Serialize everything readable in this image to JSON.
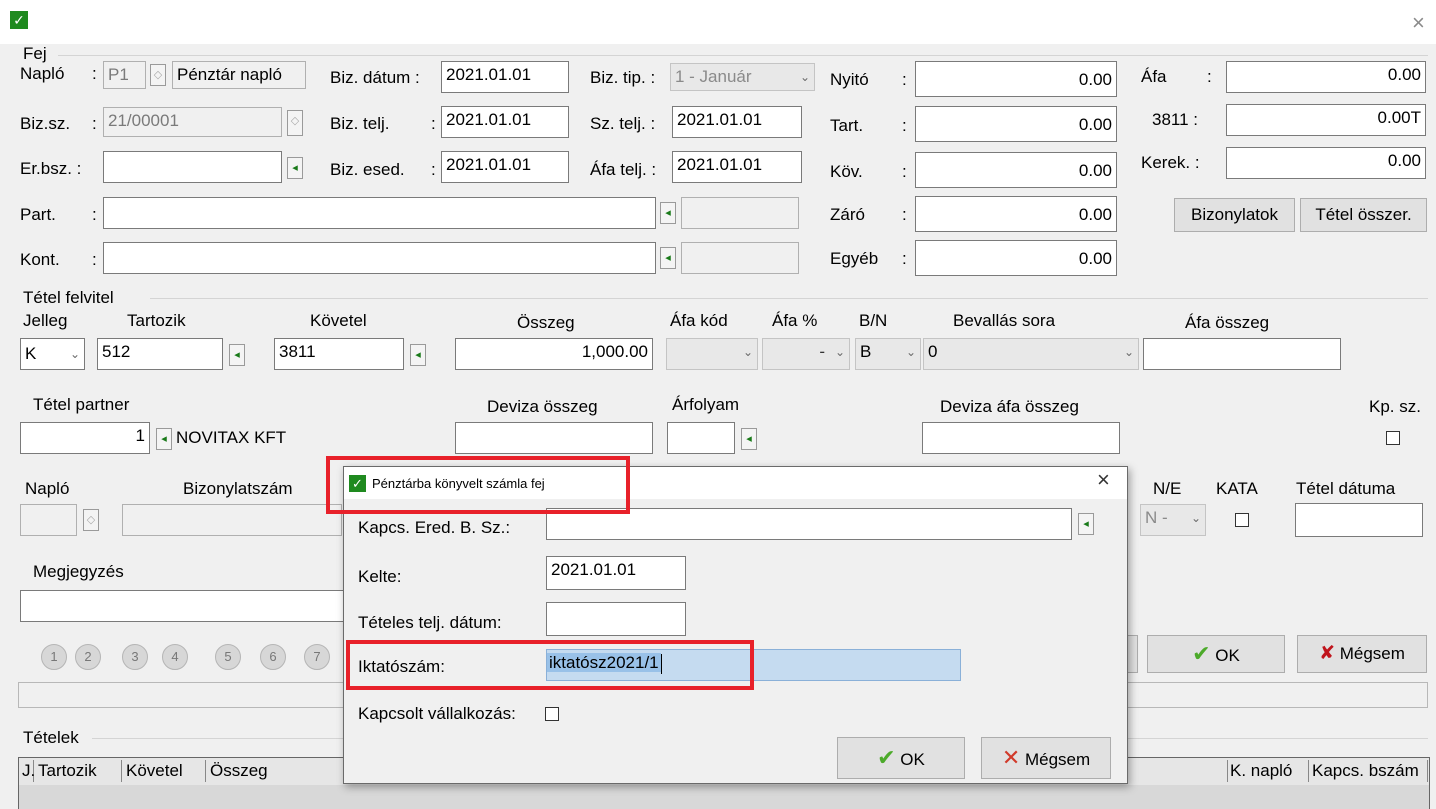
{
  "window": {
    "close_glyph": "×"
  },
  "fej": {
    "group": "Fej",
    "naplo_label": "Napló",
    "naplo_code": "P1",
    "naplo_name": "Pénztár napló",
    "bizsz_label": "Biz.sz.",
    "bizsz_value": "21/00001",
    "erbsz_label": "Er.bsz. :",
    "part_label": "Part.",
    "kont_label": "Kont.",
    "biz_datum_label": "Biz. dátum :",
    "biz_datum_value": "2021.01.01",
    "biz_telj_label": "Biz. telj.",
    "biz_telj_value": "2021.01.01",
    "biz_esed_label": "Biz. esed.",
    "biz_esed_value": "2021.01.01",
    "biz_tip_label": "Biz. tip. :",
    "biz_tip_value": "1 - Január",
    "sz_telj_label": "Sz. telj. :",
    "sz_telj_value": "2021.01.01",
    "afa_telj_label": "Áfa telj. :",
    "afa_telj_value": "2021.01.01",
    "nyito_label": "Nyitó",
    "nyito_value": "0.00",
    "tart_label": "Tart.",
    "tart_value": "0.00",
    "kov_label": "Köv.",
    "kov_value": "0.00",
    "zaro_label": "Záró",
    "zaro_value": "0.00",
    "egyeb_label": "Egyéb",
    "egyeb_value": "0.00",
    "afa_label": "Áfa",
    "afa_value": "0.00",
    "n3811_label": "3811 :",
    "n3811_value": "0.00T",
    "kerek_label": "Kerek. :",
    "kerek_value": "0.00",
    "bizonylatok_button": "Bizonylatok",
    "tetel_osszer_button": "Tétel összer."
  },
  "tetel": {
    "group": "Tétel felvitel",
    "jelleg_label": "Jelleg",
    "jelleg_value": "K",
    "tartozik_label": "Tartozik",
    "tartozik_value": "512",
    "kovetel_label": "Követel",
    "kovetel_value": "3811",
    "osszeg_label": "Összeg",
    "osszeg_value": "1,000.00",
    "afa_kod_label": "Áfa kód",
    "afa_pct_label": "Áfa %",
    "afa_pct_value": "-",
    "bn_label": "B/N",
    "bn_value": "B",
    "bevallas_label": "Bevallás sora",
    "bevallas_value": "0",
    "afa_osszeg_label": "Áfa összeg",
    "partner_label": "Tétel partner",
    "partner_value": "1",
    "partner_name": "NOVITAX KFT",
    "deviza_label": "Deviza összeg",
    "arfolyam_label": "Árfolyam",
    "deviza_afa_label": "Deviza áfa összeg",
    "kpsz_label": "Kp. sz.",
    "naplo_label": "Napló",
    "bizonylatszam_label": "Bizonylatszám",
    "ne_label": "N/E",
    "ne_value": "N -",
    "kata_label": "KATA",
    "tetel_datum_label": "Tétel dátuma",
    "megjegyzes_label": "Megjegyzés",
    "circles": [
      "1",
      "2",
      "3",
      "4",
      "5",
      "6",
      "7"
    ],
    "ok_button": "OK",
    "megsem_button": "Mégsem"
  },
  "tetelek": {
    "group": "Tételek",
    "columns": [
      "J.",
      "Tartozik",
      "Követel",
      "Összeg"
    ],
    "right_columns": [
      "K. napló",
      "Kapcs. bszám"
    ]
  },
  "dialog": {
    "title": "Pénztárba könyvelt számla fej",
    "close_glyph": "×",
    "kapcs_label": "Kapcs. Ered. B. Sz.:",
    "kapcs_value": "",
    "kelte_label": "Kelte:",
    "kelte_value": "2021.01.01",
    "teteles_label": "Tételes telj. dátum:",
    "teteles_value": "",
    "iktato_label": "Iktatószám:",
    "iktato_value": "iktatósz2021/1",
    "kapcsolt_label": "Kapcsolt vállalkozás:",
    "ok_button": "OK",
    "megsem_button": "Mégsem"
  }
}
